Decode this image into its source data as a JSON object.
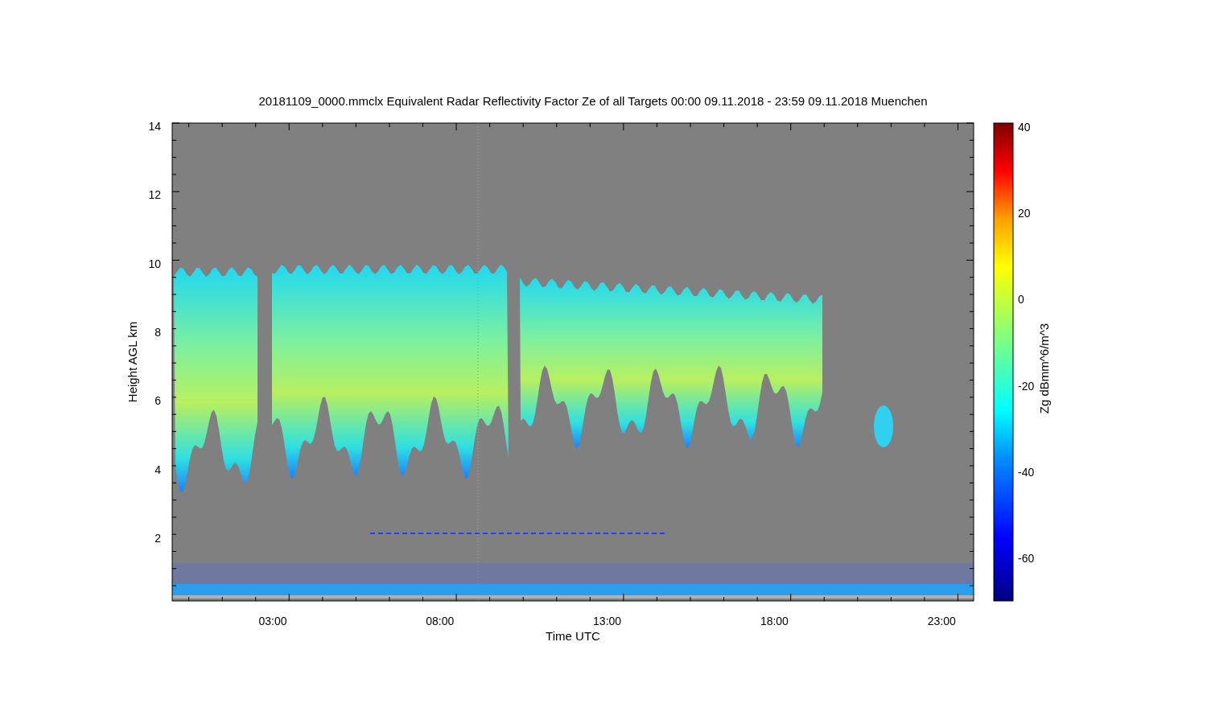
{
  "title": "20181109_0000.mmclx Equivalent Radar Reflectivity Factor Ze of all Targets   00:00 09.11.2018 - 23:59 09.11.2018 Muenchen",
  "y_axis": {
    "label": "Height AGL km",
    "ticks": [
      "14",
      "12",
      "10",
      "8",
      "6",
      "4",
      "2"
    ]
  },
  "x_axis": {
    "label": "Time UTC",
    "ticks": [
      "03:00",
      "08:00",
      "13:00",
      "18:00",
      "23:00"
    ]
  },
  "colorbar": {
    "label": "Zg dBmm^6/m^3",
    "ticks": [
      "40",
      "20",
      "0",
      "-20",
      "-40",
      "-60"
    ]
  }
}
